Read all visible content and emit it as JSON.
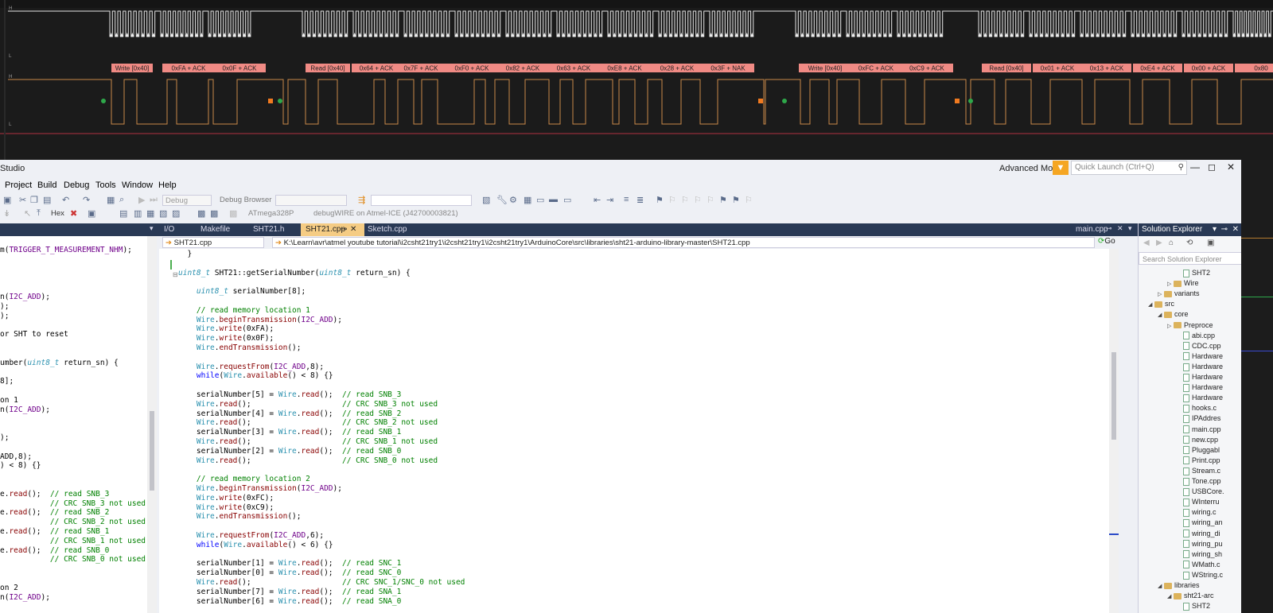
{
  "analyzer": {
    "rail_high": "H",
    "rail_low": "L",
    "decoded_labels": [
      "Write [0x40]",
      "0xFA + ACK",
      "0x0F + ACK",
      "Read [0x40]",
      "0x64 + ACK",
      "0x7F + ACK",
      "0xF0 + ACK",
      "0x82 + ACK",
      "0x63 + ACK",
      "0xE8 + ACK",
      "0x28 + ACK",
      "0x3F + NAK",
      "Write [0x40]",
      "0xFC + ACK",
      "0xC9 + ACK",
      "Read [0x40]",
      "0x01 + ACK",
      "0x13 + ACK",
      "0xE4 + ACK",
      "0x00 + ACK",
      "0x80"
    ],
    "colors": {
      "label_bg": "#f08a84",
      "sda": "#c8894a",
      "scl": "#e6e6e6",
      "start": "#2ea84a",
      "stop": "#f07a20"
    }
  },
  "vs": {
    "title": "Studio",
    "advanced_mode": "Advanced Mode",
    "quick_launch": "Quick Launch (Ctrl+Q)",
    "menu": [
      "Project",
      "Build",
      "Debug",
      "Tools",
      "Window",
      "Help"
    ],
    "toolbar": {
      "config": "Debug",
      "browser": "Debug Browser",
      "hex": "Hex",
      "device": "ATmega328P",
      "tool": "debugWIRE on Atmel-ICE (J42700003821)"
    },
    "tabs": {
      "io": "I/O",
      "makefile": "Makefile",
      "sht21h": "SHT21.h",
      "sht21cpp": "SHT21.cpp",
      "sketch": "Sketch.cpp",
      "maincpp": "main.cpp"
    },
    "nav": {
      "file": "SHT21.cpp",
      "path": "K:\\Learn\\avr\\atmel youtube tutorial\\i2csht21try1\\i2csht21try1\\i2csht21try1\\ArduinoCore\\src\\libraries\\sht21-arduino-library-master\\SHT21.cpp",
      "go": "Go"
    },
    "left_code": [
      "m(TRIGGER_T_MEASUREMENT_NHM);",
      "",
      "",
      "",
      "",
      "n(I2C_ADD);",
      ");",
      ");",
      "",
      "or SHT to reset",
      "",
      "",
      "umber(uint8_t return_sn) {",
      "",
      "8];",
      "",
      "on 1",
      "n(I2C_ADD);",
      "",
      "",
      ");",
      "",
      "ADD,8);",
      ") < 8) {}",
      "",
      "",
      "e.read();  // read SNB_3",
      "           // CRC SNB_3 not used",
      "e.read();  // read SNB_2",
      "           // CRC SNB_2 not used",
      "e.read();  // read SNB_1",
      "           // CRC SNB_1 not used",
      "e.read();  // read SNB_0",
      "           // CRC SNB_0 not used",
      "",
      "",
      "on 2",
      "n(I2C_ADD);"
    ],
    "main_code": [
      "  }",
      "",
      "uint8_t SHT21::getSerialNumber(uint8_t return_sn) {",
      "",
      "    uint8_t serialNumber[8];",
      "",
      "    // read memory location 1",
      "    Wire.beginTransmission(I2C_ADD);",
      "    Wire.write(0xFA);",
      "    Wire.write(0x0F);",
      "    Wire.endTransmission();",
      "",
      "    Wire.requestFrom(I2C_ADD,8);",
      "    while(Wire.available() < 8) {}",
      "",
      "    serialNumber[5] = Wire.read();  // read SNB_3",
      "    Wire.read();                    // CRC SNB_3 not used",
      "    serialNumber[4] = Wire.read();  // read SNB_2",
      "    Wire.read();                    // CRC SNB_2 not used",
      "    serialNumber[3] = Wire.read();  // read SNB_1",
      "    Wire.read();                    // CRC SNB_1 not used",
      "    serialNumber[2] = Wire.read();  // read SNB_0",
      "    Wire.read();                    // CRC SNB_0 not used",
      "",
      "    // read memory location 2",
      "    Wire.beginTransmission(I2C_ADD);",
      "    Wire.write(0xFC);",
      "    Wire.write(0xC9);",
      "    Wire.endTransmission();",
      "",
      "    Wire.requestFrom(I2C_ADD,6);",
      "    while(Wire.available() < 6) {}",
      "",
      "    serialNumber[1] = Wire.read();  // read SNC_1",
      "    serialNumber[0] = Wire.read();  // read SNC_0",
      "    Wire.read();                    // CRC SNC_1/SNC_0 not used",
      "    serialNumber[7] = Wire.read();  // read SNA_1",
      "    serialNumber[6] = Wire.read();  // read SNA_0"
    ],
    "solution": {
      "title": "Solution Explorer",
      "search": "Search Solution Explorer",
      "nodes": [
        {
          "label": "SHT2",
          "kind": "file",
          "indent": 5,
          "expand": ""
        },
        {
          "label": "Wire",
          "kind": "folder",
          "indent": 4,
          "expand": "▷"
        },
        {
          "label": "variants",
          "kind": "folder",
          "indent": 3,
          "expand": "▷"
        },
        {
          "label": "src",
          "kind": "folder",
          "indent": 2,
          "expand": "◢"
        },
        {
          "label": "core",
          "kind": "folder",
          "indent": 3,
          "expand": "◢"
        },
        {
          "label": "Preproce",
          "kind": "folder",
          "indent": 4,
          "expand": "▷"
        },
        {
          "label": "abi.cpp",
          "kind": "file",
          "indent": 5,
          "expand": ""
        },
        {
          "label": "CDC.cpp",
          "kind": "file",
          "indent": 5,
          "expand": ""
        },
        {
          "label": "Hardware",
          "kind": "file",
          "indent": 5,
          "expand": ""
        },
        {
          "label": "Hardware",
          "kind": "file",
          "indent": 5,
          "expand": ""
        },
        {
          "label": "Hardware",
          "kind": "file",
          "indent": 5,
          "expand": ""
        },
        {
          "label": "Hardware",
          "kind": "file",
          "indent": 5,
          "expand": ""
        },
        {
          "label": "Hardware",
          "kind": "file",
          "indent": 5,
          "expand": ""
        },
        {
          "label": "hooks.c",
          "kind": "file",
          "indent": 5,
          "expand": ""
        },
        {
          "label": "IPAddres",
          "kind": "file",
          "indent": 5,
          "expand": ""
        },
        {
          "label": "main.cpp",
          "kind": "file",
          "indent": 5,
          "expand": ""
        },
        {
          "label": "new.cpp",
          "kind": "file",
          "indent": 5,
          "expand": ""
        },
        {
          "label": "Pluggabl",
          "kind": "file",
          "indent": 5,
          "expand": ""
        },
        {
          "label": "Print.cpp",
          "kind": "file",
          "indent": 5,
          "expand": ""
        },
        {
          "label": "Stream.c",
          "kind": "file",
          "indent": 5,
          "expand": ""
        },
        {
          "label": "Tone.cpp",
          "kind": "file",
          "indent": 5,
          "expand": ""
        },
        {
          "label": "USBCore.",
          "kind": "file",
          "indent": 5,
          "expand": ""
        },
        {
          "label": "WInterru",
          "kind": "file",
          "indent": 5,
          "expand": ""
        },
        {
          "label": "wiring.c",
          "kind": "file",
          "indent": 5,
          "expand": ""
        },
        {
          "label": "wiring_an",
          "kind": "file",
          "indent": 5,
          "expand": ""
        },
        {
          "label": "wiring_di",
          "kind": "file",
          "indent": 5,
          "expand": ""
        },
        {
          "label": "wiring_pu",
          "kind": "file",
          "indent": 5,
          "expand": ""
        },
        {
          "label": "wiring_sh",
          "kind": "file",
          "indent": 5,
          "expand": ""
        },
        {
          "label": "WMath.c",
          "kind": "file",
          "indent": 5,
          "expand": ""
        },
        {
          "label": "WString.c",
          "kind": "file",
          "indent": 5,
          "expand": ""
        },
        {
          "label": "libraries",
          "kind": "folder",
          "indent": 3,
          "expand": "◢"
        },
        {
          "label": "sht21-arc",
          "kind": "folder",
          "indent": 4,
          "expand": "◢"
        },
        {
          "label": "SHT2",
          "kind": "file",
          "indent": 5,
          "expand": ""
        }
      ]
    }
  }
}
